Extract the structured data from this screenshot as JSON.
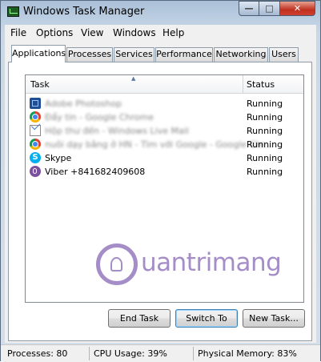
{
  "window": {
    "title": "Windows Task Manager",
    "controls": {
      "minimize": "—",
      "maximize": "□",
      "close": "✕"
    }
  },
  "menu": [
    "File",
    "Options",
    "View",
    "Windows",
    "Help"
  ],
  "tabs": [
    "Applications",
    "Processes",
    "Services",
    "Performance",
    "Networking",
    "Users"
  ],
  "active_tab": "Applications",
  "list": {
    "headers": {
      "task": "Task",
      "status": "Status"
    },
    "rows": [
      {
        "icon": "photoshop-icon",
        "name": "Adobe Photoshop",
        "status": "Running",
        "blurred": true
      },
      {
        "icon": "chrome-icon",
        "name": "Đẩy tin - Google Chrome",
        "status": "Running",
        "blurred": true
      },
      {
        "icon": "mail-icon",
        "name": "Hộp thư đến - Windows Live Mail",
        "status": "Running",
        "blurred": true
      },
      {
        "icon": "chrome-icon",
        "name": "nuôi dạy bằng ở HN - Tìm với Google - Google Chr...",
        "status": "Running",
        "blurred": true
      },
      {
        "icon": "skype-icon",
        "name": "Skype",
        "status": "Running",
        "blurred": false
      },
      {
        "icon": "viber-icon",
        "name": "Viber +841682409608",
        "status": "Running",
        "blurred": false
      }
    ]
  },
  "watermark": "uantrimang",
  "buttons": {
    "end_task": "End Task",
    "switch_to": "Switch To",
    "new_task": "New Task..."
  },
  "statusbar": {
    "processes": "Processes: 80",
    "cpu": "CPU Usage: 39%",
    "memory": "Physical Memory: 83%"
  }
}
